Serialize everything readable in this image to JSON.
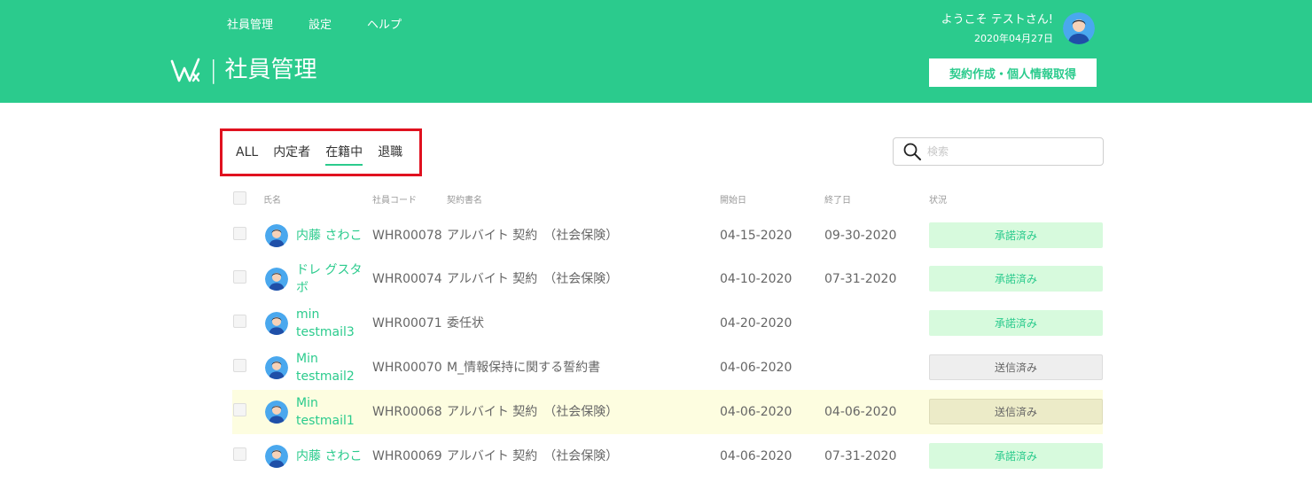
{
  "nav": [
    "社員管理",
    "設定",
    "ヘルプ"
  ],
  "brand": {
    "separator": "|",
    "title": "社員管理"
  },
  "user": {
    "welcome": "ようこそ テストさん!",
    "date": "2020年04月27日"
  },
  "cta_label": "契約作成・個人情報取得",
  "tabs": [
    "ALL",
    "内定者",
    "在籍中",
    "退職"
  ],
  "active_tab": "在籍中",
  "search": {
    "placeholder": "検索"
  },
  "columns": [
    "氏名",
    "社員コード",
    "契約書名",
    "開始日",
    "終了日",
    "状況"
  ],
  "rows": [
    {
      "name": "内藤 さわこ",
      "code": "WHR00078",
      "doc": "アルバイト 契約　（社会保険）",
      "start": "04-15-2020",
      "end": "09-30-2020",
      "status": "承諾済み"
    },
    {
      "name": "ドレ グスタボ",
      "code": "WHR00074",
      "doc": "アルバイト 契約　（社会保険）",
      "start": "04-10-2020",
      "end": "07-31-2020",
      "status": "承諾済み"
    },
    {
      "name": "min testmail3",
      "code": "WHR00071",
      "doc": "委任状",
      "start": "04-20-2020",
      "end": "",
      "status": "承諾済み"
    },
    {
      "name": "Min testmail2",
      "code": "WHR00070",
      "doc": "M_情報保持に関する誓約書",
      "start": "04-06-2020",
      "end": "",
      "status": "送信済み"
    },
    {
      "name": "Min testmail1",
      "code": "WHR00068",
      "doc": "アルバイト 契約　（社会保険）",
      "start": "04-06-2020",
      "end": "04-06-2020",
      "status": "送信済み"
    },
    {
      "name": "内藤 さわこ",
      "code": "WHR00069",
      "doc": "アルバイト 契約　（社会保険）",
      "start": "04-06-2020",
      "end": "07-31-2020",
      "status": "承諾済み"
    }
  ],
  "colors": {
    "brand_green": "#2bcb8d",
    "highlight_box": "#e0111f",
    "row_highlight": "#fdfde0"
  }
}
